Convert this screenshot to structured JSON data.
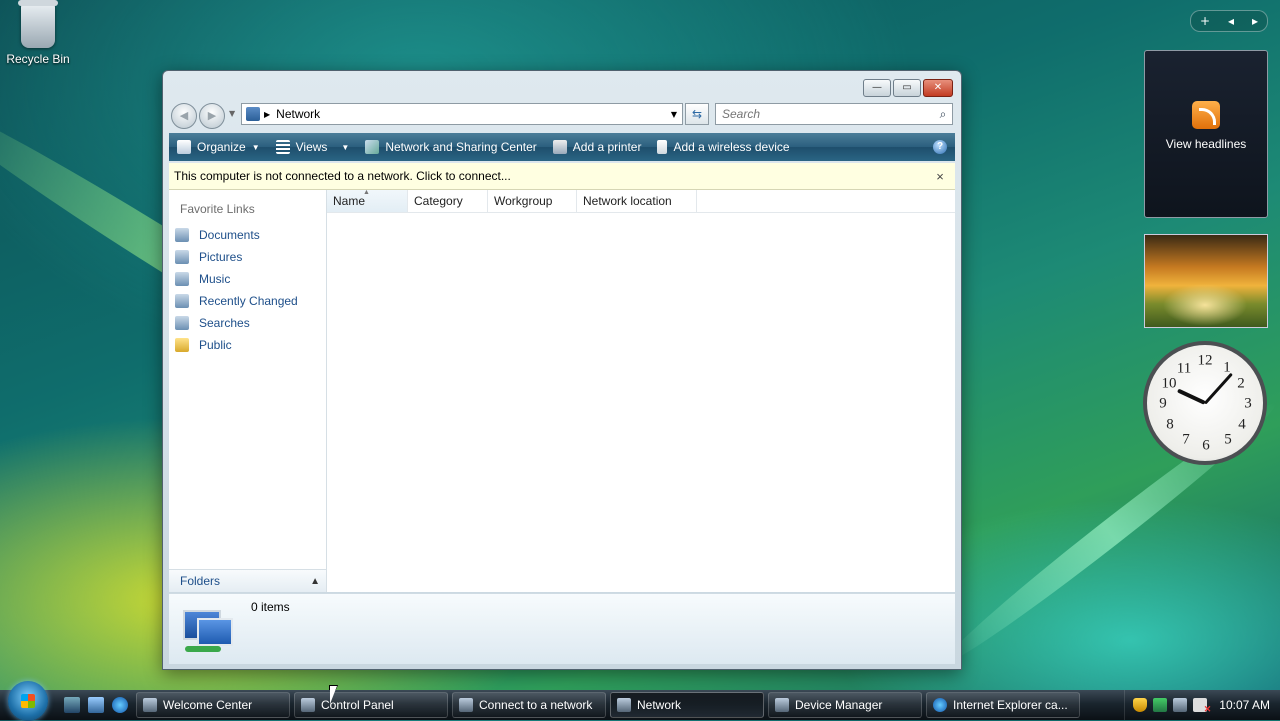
{
  "desktop": {
    "recycle_bin_label": "Recycle Bin"
  },
  "window": {
    "title_buttons": {
      "minimize": "—",
      "maximize": "▭",
      "close": "✕"
    },
    "address": {
      "location": "Network"
    },
    "search": {
      "placeholder": "Search"
    },
    "toolbar": {
      "organize": "Organize",
      "views": "Views",
      "network_sharing": "Network and Sharing Center",
      "add_printer": "Add a printer",
      "add_wireless": "Add a wireless device",
      "help": "?"
    },
    "infobar": {
      "message": "This computer is not connected to a network. Click to connect...",
      "close": "×"
    },
    "nav": {
      "favorite_links_title": "Favorite Links",
      "items": [
        {
          "label": "Documents"
        },
        {
          "label": "Pictures"
        },
        {
          "label": "Music"
        },
        {
          "label": "Recently Changed"
        },
        {
          "label": "Searches"
        },
        {
          "label": "Public"
        }
      ],
      "folders_label": "Folders"
    },
    "columns": [
      "Name",
      "Category",
      "Workgroup",
      "Network location"
    ],
    "details": {
      "count": "0 items"
    }
  },
  "sidebar": {
    "feed_label": "View headlines"
  },
  "taskbar": {
    "tasks": [
      {
        "label": "Welcome Center"
      },
      {
        "label": "Control Panel"
      },
      {
        "label": "Connect to a network"
      },
      {
        "label": "Network"
      },
      {
        "label": "Device Manager"
      },
      {
        "label": "Internet Explorer ca..."
      }
    ],
    "active_task": "Network",
    "clock": "10:07 AM"
  },
  "clock_gadget": {
    "numbers": [
      "12",
      "1",
      "2",
      "3",
      "4",
      "5",
      "6",
      "7",
      "8",
      "9",
      "10",
      "11"
    ]
  },
  "colors": {
    "toolbar": "#2b5f7e",
    "link": "#1e4f8a",
    "infobar": "#ffffe1"
  }
}
